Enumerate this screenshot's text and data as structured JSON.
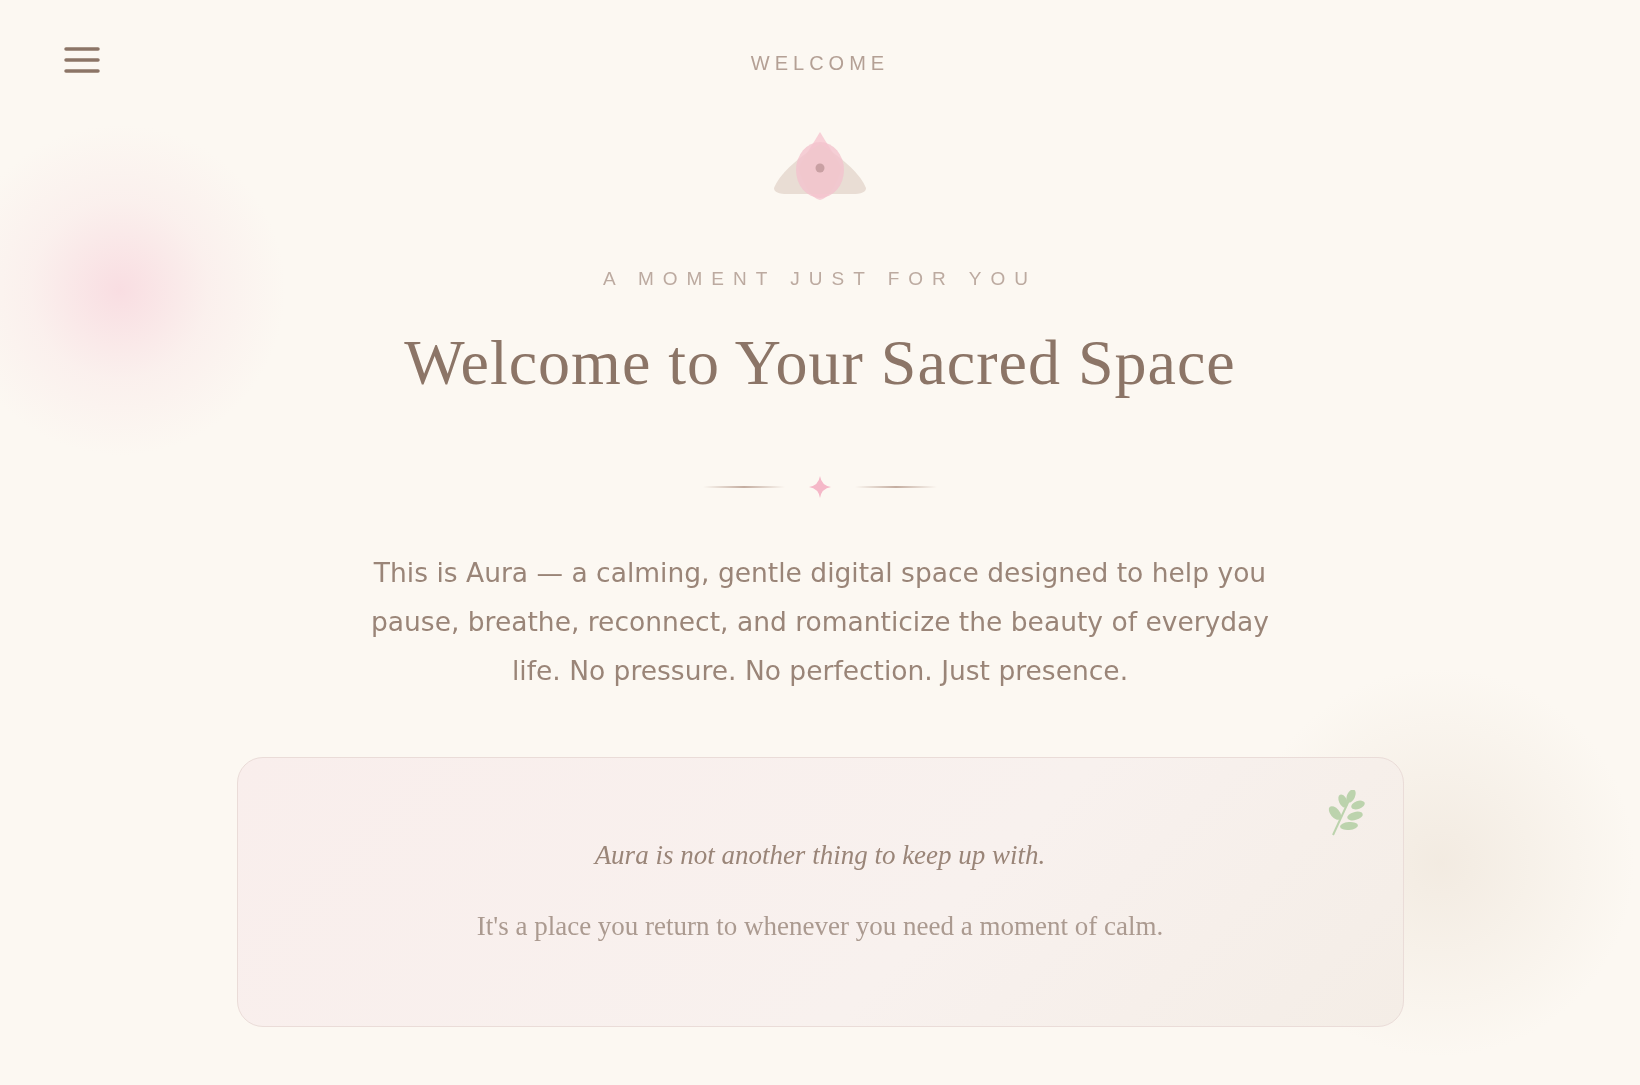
{
  "header": {
    "title": "WELCOME"
  },
  "eyebrow": "A MOMENT JUST FOR YOU",
  "heading": "Welcome to Your Sacred Space",
  "intro": "This is Aura — a calming, gentle digital space designed to help you pause, breathe, reconnect, and romanticize the beauty of everyday life. No pressure. No perfection. Just presence.",
  "card": {
    "lead": "Aura is not another thing to keep up with.",
    "text": "It's a place you return to whenever you need a moment of calm."
  }
}
